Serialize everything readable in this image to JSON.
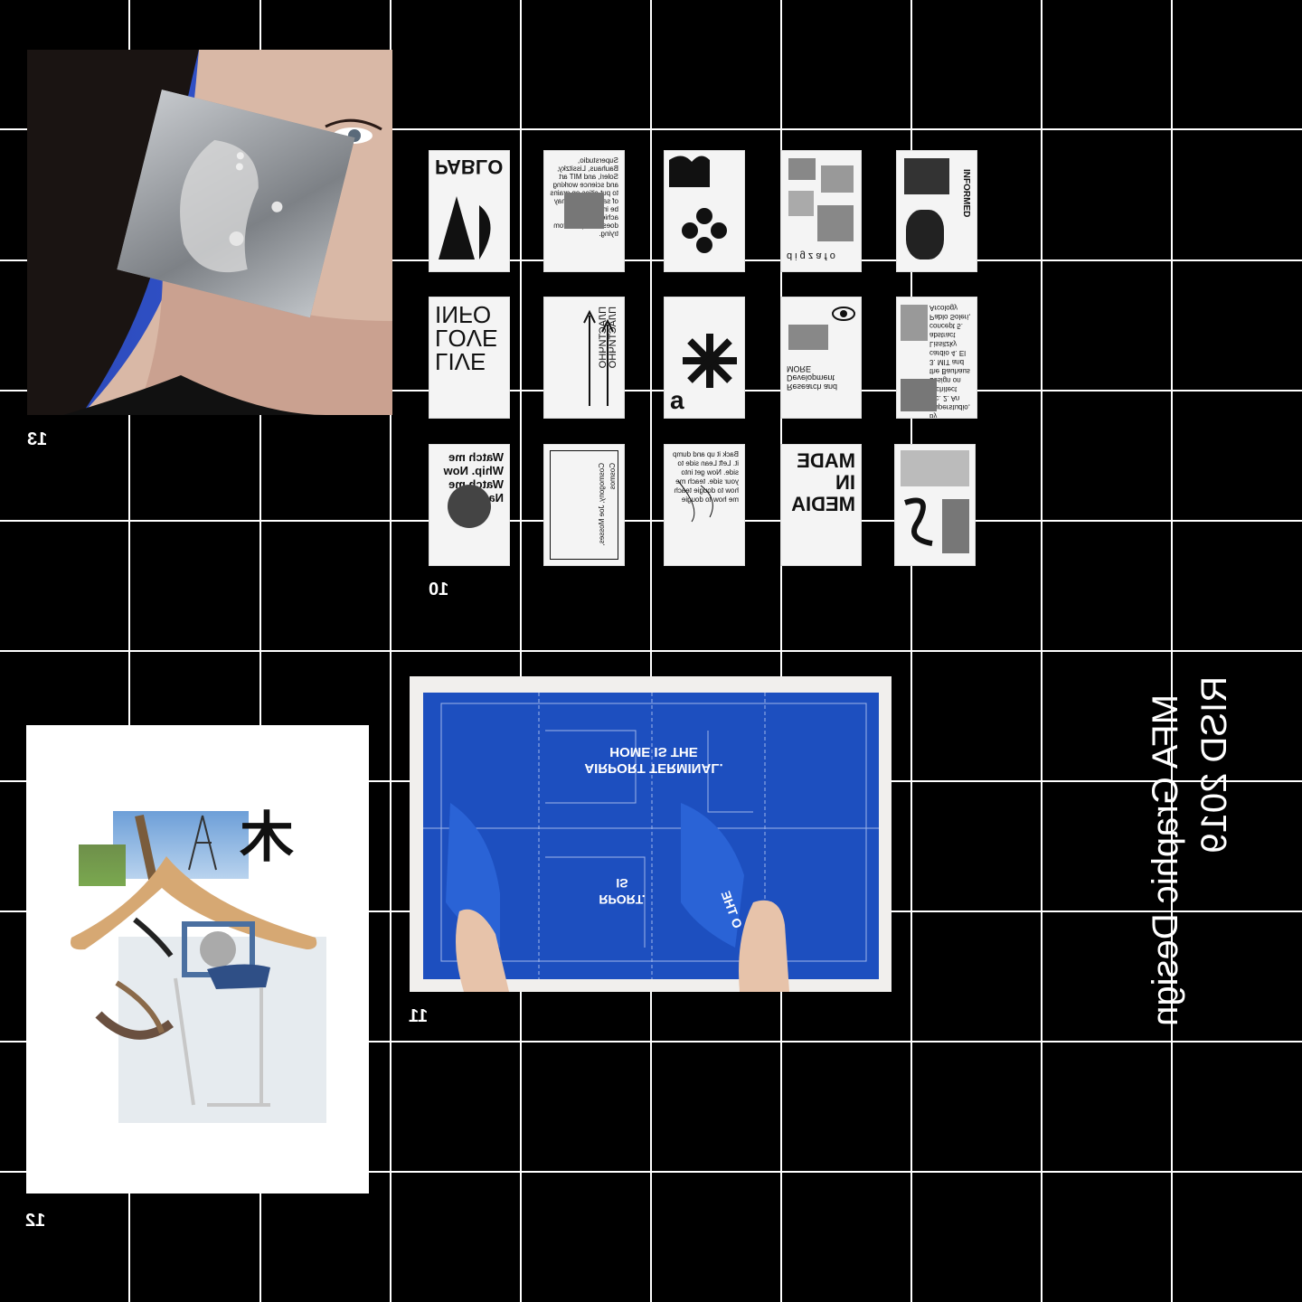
{
  "title": {
    "line1": "RISD 2019",
    "line2": "MFA Graphic Design"
  },
  "items": [
    {
      "number": "13"
    },
    {
      "number": "10"
    },
    {
      "number": "11"
    },
    {
      "number": "12"
    }
  ],
  "posters": [
    {
      "text": "PABLO"
    },
    {
      "text": "Superstudio, Bauhaus, Lissitzky, Soleri, and MIT art and science working to put cities on grains of sand. Utopia may be impossible to achieve, but that doesn't stop us from trying."
    },
    {
      "text": ""
    },
    {
      "text": "d i g z a f o"
    },
    {
      "text": "INFORMED"
    },
    {
      "text": "LIVE LOVE INFO"
    },
    {
      "text": "ПЛАСТИЧНО ПЛАСТИЧНО"
    },
    {
      "text": "a"
    },
    {
      "text": "Research and Development MORE"
    },
    {
      "text": "1. A collage by Superstudio, etc. 2. An architect design on the Bauhaus 3. MIT and cardio 4. El Lissitzky abstract concept 5. Pablo Soleri, Arcology"
    },
    {
      "text": "Watch me Whip. Now Watch me Nae Nae."
    },
    {
      "text": "Cosmogony, Joe Mosses, Cosmos"
    },
    {
      "text": "Back it up and dump it. Left Lean side to side. Now get into your side. teach me how to dougie teach me how to dougie"
    },
    {
      "text": "MADE IN MEDIA"
    },
    {
      "text": ""
    }
  ],
  "poster11": {
    "headline_line1": "HOME IS THE",
    "headline_line2": "AIRPORT TERMINAL.",
    "fragment_line1": "IS",
    "fragment_line2": "RPORT.",
    "peel_text": "O THE"
  },
  "collage12": {
    "glyph": "木"
  },
  "colors": {
    "background": "#000000",
    "grid": "#ffffff",
    "poster_blue": "#1d4fbf",
    "photo_blue": "#2f4fc4"
  }
}
